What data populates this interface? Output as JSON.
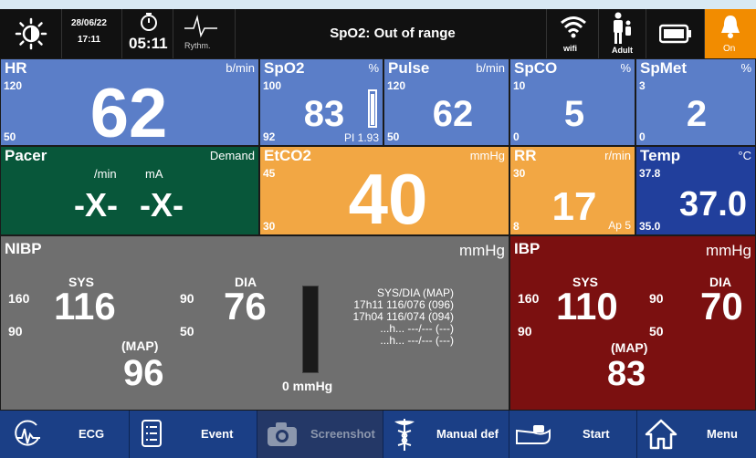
{
  "statusbar": {
    "date": "28/06/22",
    "time": "17:11",
    "timer": "05:11",
    "rhythm_label": "Rythm.",
    "alarm_message": "SpO2: Out of range",
    "wifi_label": "wifi",
    "patient_label": "Adult",
    "alarm_state": "On",
    "icons": [
      "brightness-icon",
      "timer-icon",
      "rhythm-icon",
      "wifi-icon",
      "adult-patient-icon",
      "battery-icon",
      "alarm-bell-icon"
    ]
  },
  "tiles": {
    "hr": {
      "name": "HR",
      "unit": "b/min",
      "high": "120",
      "low": "50",
      "value": "62"
    },
    "spo2": {
      "name": "SpO2",
      "unit": "%",
      "high": "100",
      "low": "92",
      "value": "83",
      "pi_label": "PI",
      "pi_value": "1.93"
    },
    "pulse": {
      "name": "Pulse",
      "unit": "b/min",
      "high": "120",
      "low": "50",
      "value": "62"
    },
    "spco": {
      "name": "SpCO",
      "unit": "%",
      "high": "10",
      "low": "0",
      "value": "5"
    },
    "spmet": {
      "name": "SpMet",
      "unit": "%",
      "high": "3",
      "low": "0",
      "value": "2"
    },
    "pacer": {
      "name": "Pacer",
      "mode": "Demand",
      "rate_unit": "/min",
      "current_unit": "mA",
      "rate_value": "-X-",
      "current_value": "-X-"
    },
    "etco2": {
      "name": "EtCO2",
      "unit": "mmHg",
      "high": "45",
      "low": "30",
      "value": "40"
    },
    "rr": {
      "name": "RR",
      "unit": "r/min",
      "high": "30",
      "low": "8",
      "value": "17",
      "apnea_label": "Ap",
      "apnea_value": "5"
    },
    "temp": {
      "name": "Temp",
      "unit": "°C",
      "high": "37.8",
      "low": "35.0",
      "value": "37.0"
    },
    "nibp": {
      "name": "NIBP",
      "unit": "mmHg",
      "sys_label": "SYS",
      "sys_high": "160",
      "sys_low": "90",
      "sys_value": "116",
      "dia_label": "DIA",
      "dia_high": "90",
      "dia_low": "50",
      "dia_value": "76",
      "map_label": "(MAP)",
      "map_value": "96",
      "cuff_pressure": "0 mmHg",
      "history_header": "SYS/DIA (MAP)",
      "history": [
        "17h11 116/076 (096)",
        "17h04 116/074 (094)",
        "...h... ---/--- (---)",
        "...h... ---/--- (---)"
      ]
    },
    "ibp": {
      "name": "IBP",
      "unit": "mmHg",
      "sys_label": "SYS",
      "sys_high": "160",
      "sys_low": "90",
      "sys_value": "110",
      "dia_label": "DIA",
      "dia_high": "90",
      "dia_low": "50",
      "dia_value": "70",
      "map_label": "(MAP)",
      "map_value": "83"
    }
  },
  "bottombar": {
    "ecg": "ECG",
    "event": "Event",
    "screenshot": "Screenshot",
    "manual_def": "Manual def",
    "start": "Start",
    "menu": "Menu"
  },
  "colors": {
    "tile_blue": "#5b7ec8",
    "tile_blue_dark": "#213f9c",
    "tile_green": "#08573a",
    "tile_orange": "#f2a744",
    "tile_gray": "#6f6f6f",
    "tile_red": "#7b1010",
    "alarm_orange": "#f28c00",
    "bottombar_blue": "#1b3f86"
  }
}
